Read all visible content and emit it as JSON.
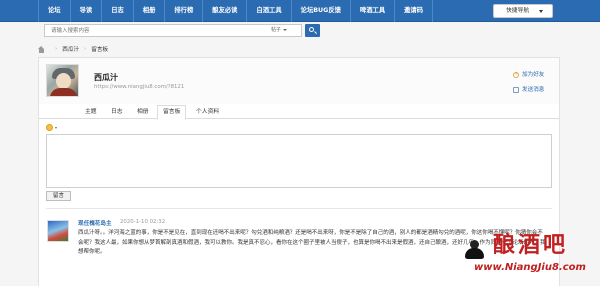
{
  "nav": {
    "items": [
      "论坛",
      "导读",
      "日志",
      "相册",
      "排行榜",
      "酿友必读",
      "白酒工具",
      "论坛BUG反馈",
      "啤酒工具",
      "邀请码"
    ],
    "quick_nav": "快捷导航"
  },
  "search": {
    "placeholder": "请输入搜索内容",
    "scope": "帖子"
  },
  "breadcrumb": {
    "items": [
      "西瓜汁",
      "留言板"
    ]
  },
  "profile": {
    "username": "西瓜汁",
    "url": "https://www.niangjiu8.com/?8121",
    "add_friend": "加为好友",
    "send_message": "发送消息"
  },
  "tabs": [
    "主题",
    "日志",
    "相册",
    "留言板",
    "个人资料"
  ],
  "active_tab": "留言板",
  "form": {
    "submit_label": "留言"
  },
  "comment": {
    "author": "现任槐花岛主",
    "time": "2020-1-10 02:32",
    "text": "西瓜汁呀。。洋河海之蓝的事，你是不是见在，直到现在还喝不出来呢？勾兑酒和纯粮酒？还是喝不出来呀，你是不是除了自己的酒，别人的都是酒精勾兑的酒呢，你这你喝不懂呢？你猜你会不会呢？我这人最，如果你想从梦首解剖真酒和假酒，我可以教你。我是真不忍心，看你在这个圈子里被人当傻子，也算是你喝不出来是假酒，还自己酿酒，还好几年，作为同是一个论坛的人，我想帮你呢。"
  },
  "watermark": {
    "logo": "酿酒吧",
    "url": "www.NiangJiu8.com"
  },
  "colors": {
    "nav_bg": "#2b6bb1",
    "link": "#2b6bb1",
    "watermark": "#c0201f"
  }
}
